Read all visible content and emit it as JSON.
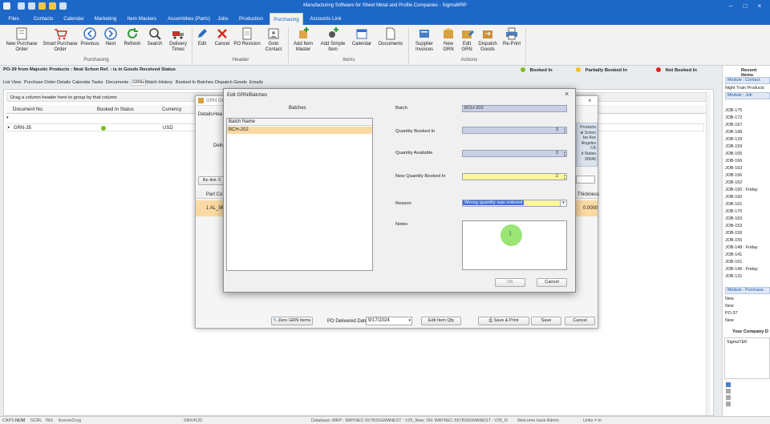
{
  "window": {
    "title": "Manufacturing Software for Sheet Metal and Profile Companies - SigmaMRP"
  },
  "menu": [
    "Files",
    "Contacts",
    "Calendar",
    "Marketing",
    "Item Masters",
    "Assemblies (Parts)",
    "Jobs",
    "Production",
    "Purchasing",
    "Accounts Link"
  ],
  "ribbon": {
    "purchasing": [
      "New Purchase Order",
      "Smart Purchase Order",
      "Previous",
      "Next",
      "Refresh",
      "Search",
      "Delivery Times"
    ],
    "purchasing_label": "Purchasing",
    "header": [
      "Edit",
      "Cancel",
      "PO Revision",
      "Goto Contact"
    ],
    "header_label": "Header",
    "items": [
      "Add Item Master",
      "Add Simple Item",
      "Calendar",
      "Documents"
    ],
    "items_label": "Items",
    "actions": [
      "Supplier Invoices",
      "New GRN",
      "Edit GRN",
      "Dispatch Goods",
      "Re-Print"
    ],
    "actions_label": "Actions"
  },
  "status": {
    "po_line": "PO-39 from Majestic Products : Neal Schon Ref. : is in Goods Received Status",
    "legend": [
      {
        "label": "Booked In",
        "color": "#7fbf1e"
      },
      {
        "label": "Partially Booked In",
        "color": "#f2c21a"
      },
      {
        "label": "Not Booked In",
        "color": "#e0261c"
      }
    ]
  },
  "tabs": [
    "List View",
    "Purchase Order Details",
    "Calendar Tasks",
    "Documents",
    "GRNs",
    "Match History",
    "Booked In Batches",
    "Dispatch Goods",
    "Emails"
  ],
  "grid": {
    "group_hint": "Drag a column header here to group by that column",
    "columns": [
      "Document No.",
      "Booked In Status",
      "Currency"
    ],
    "row": {
      "doc": "GRN-35",
      "currency": "USD"
    }
  },
  "grn_window": {
    "title": "GRN De",
    "tabs": [
      "Details",
      "Hea"
    ],
    "deliv_label": "Deliv",
    "relink": "Re-link S",
    "part_col": "Part Co",
    "row_text": "1  AL_96x",
    "address": [
      "Products",
      "al Schon",
      "fax Ave",
      "Angeles",
      "CA",
      "d States",
      "90046"
    ],
    "thickness_label": "Thickness",
    "thickness_value": "0.0000",
    "zero_btn": "Zero GRN Items",
    "po_date_label": "PO Delivered Date",
    "po_date": "9/17/2024",
    "edit_qty": "Edit Item Qty",
    "save_print": "Save & Print",
    "save": "Save",
    "cancel": "Cancel"
  },
  "dialog": {
    "title": "Edit GRN/Batches",
    "batches_label": "Batches",
    "batch_col": "Batch Name",
    "batch_row": "BCH-202",
    "batch_label": "Batch",
    "batch_value": "BCH-202",
    "qty_booked_label": "Quantity Booked In",
    "qty_booked": "3",
    "qty_avail_label": "Quantity Available",
    "qty_avail": "3",
    "new_qty_label": "New Quantity Booked In",
    "new_qty": "2",
    "reason_label": "Reason",
    "reason": "Wrong quantity was entered",
    "notes_label": "Notes",
    "ok": "OK",
    "cancel": "Cancel"
  },
  "right_panel": {
    "title": "Recent Items",
    "module_contact": "Module : Contact",
    "contact_item": "Night Train Products",
    "module_job": "Module : Job",
    "jobs": [
      "JOB-175",
      "JOB-172",
      "JOB-167",
      "JOB-168",
      "JOB-133",
      "JOB-159",
      "JOB-165",
      "JOB-166",
      "JOB-163",
      "JOB-156",
      "JOB-162",
      "JOB-150 : Friday",
      "JOB-160",
      "JOB-161",
      "JOB-170",
      "JOB-163",
      "JOB-153",
      "JOB-159",
      "JOB-155",
      "JOB-148 : Friday",
      "JOB-141",
      "JOB-151",
      "JOB-149 : Friday",
      "JOB-131"
    ],
    "module_purchase": "Module : Purchase",
    "purchases": [
      "New",
      "New",
      "PO-37",
      "New"
    ],
    "company_label": "Your Company D",
    "company": "SigmaTEK"
  },
  "statusbar": {
    "caps": "CAPS",
    "num": "NUM",
    "scrl": "SCRL",
    "ins": "INS",
    "license": "license2cvg",
    "snx": "SNX4120",
    "database": "Database: MRP : WAYNEC-5578\\SIGMANEST : V25_New; SN: WAYNEC-5578\\SIGMANEST : V25_N",
    "welcome": "Welcome back Admin",
    "units": "Units = in"
  }
}
